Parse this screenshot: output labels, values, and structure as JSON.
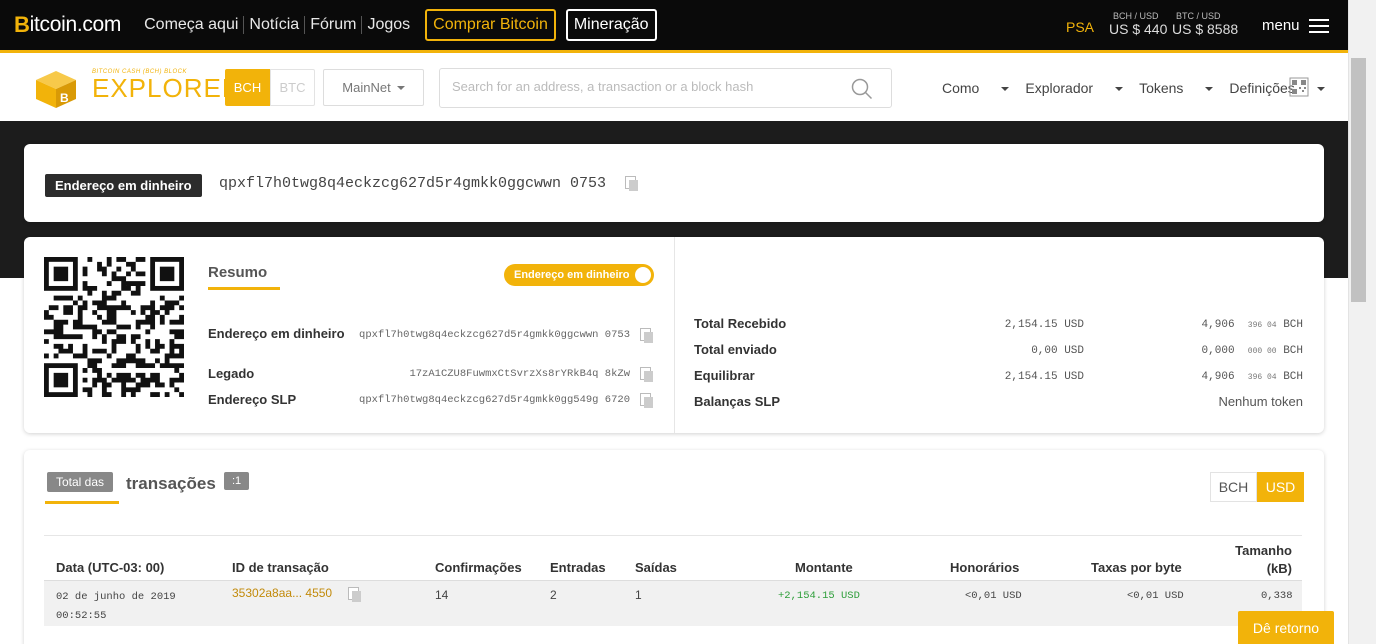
{
  "topbar": {
    "brand_prefix": "B",
    "brand_rest": "itcoin.com",
    "nav": [
      "Começa aqui",
      "Notícia",
      "Fórum",
      "Jogos"
    ],
    "buy_label": "Comprar Bitcoin",
    "mine_label": "Mineração",
    "psa": "PSA",
    "bch_price_label": "BCH / USD",
    "bch_price": "US $ 440",
    "btc_price_label": "BTC / USD",
    "btc_price": "US $ 8588",
    "menu_label": "menu"
  },
  "explorer": {
    "logo_small": "BITCOIN CASH (BCH) BLOCK",
    "logo_big": "EXPLORER",
    "bch": "BCH",
    "btc": "BTC",
    "network": "MainNet",
    "search_placeholder": "Search for an address, a transaction or a block hash",
    "nav": [
      "Como",
      "Explorador",
      "Tokens",
      "Definições"
    ]
  },
  "address": {
    "badge": "Endereço em dinheiro",
    "value": "qpxfl7h0twg8q4eckzcg627d5r4gmkk0ggcwwn 0753"
  },
  "summary": {
    "title": "Resumo",
    "toggle": "Endereço em dinheiro",
    "rows": [
      {
        "label": "Endereço em dinheiro",
        "value": "qpxfl7h0twg8q4eckzcg627d5r4gmkk0ggcwwn 0753"
      },
      {
        "label": "Legado",
        "value": "17zA1CZU8FuwmxCtSvrzXs8rYRkB4q 8kZw"
      },
      {
        "label": "Endereço SLP",
        "value": "qpxfl7h0twg8q4eckzcg627d5r4gmkk0gg549g 6720"
      }
    ],
    "totals": [
      {
        "label": "Total Recebido",
        "usd": "2,154.15 USD",
        "bch_main": "4,906",
        "bch_small": "396 04",
        "bch_unit": "BCH"
      },
      {
        "label": "Total enviado",
        "usd": "0,00 USD",
        "bch_main": "0,000",
        "bch_small": "000 00",
        "bch_unit": "BCH"
      },
      {
        "label": "Equilibrar",
        "usd": "2,154.15 USD",
        "bch_main": "4,906",
        "bch_small": "396 04",
        "bch_unit": "BCH"
      }
    ],
    "slp_label": "Balanças SLP",
    "slp_value": "Nenhum token"
  },
  "transactions": {
    "total_badge": "Total das",
    "title": "transações",
    "count": ":1",
    "cur_bch": "BCH",
    "cur_usd": "USD",
    "headers": {
      "date": "Data (UTC-03: 00)",
      "txid": "ID de transação",
      "confirmations": "Confirmações",
      "inputs": "Entradas",
      "outputs": "Saídas",
      "amount": "Montante",
      "fees": "Honorários",
      "fee_rate": "Taxas por byte",
      "size_1": "Tamanho",
      "size_2": "(kB)"
    },
    "rows": [
      {
        "date": "02 de junho de 2019",
        "time": "00:52:55",
        "txid": "35302a8aa... 4550",
        "confirmations": "14",
        "inputs": "2",
        "outputs": "1",
        "amount": "+2,154.15 USD",
        "fees": "<0,01 USD",
        "fee_rate": "<0,01 USD",
        "size": "0,338"
      }
    ]
  },
  "feedback": "Dê retorno",
  "colors": {
    "accent": "#f2b30a",
    "dark": "#0a0a0a",
    "positive": "#2e9e3a"
  }
}
